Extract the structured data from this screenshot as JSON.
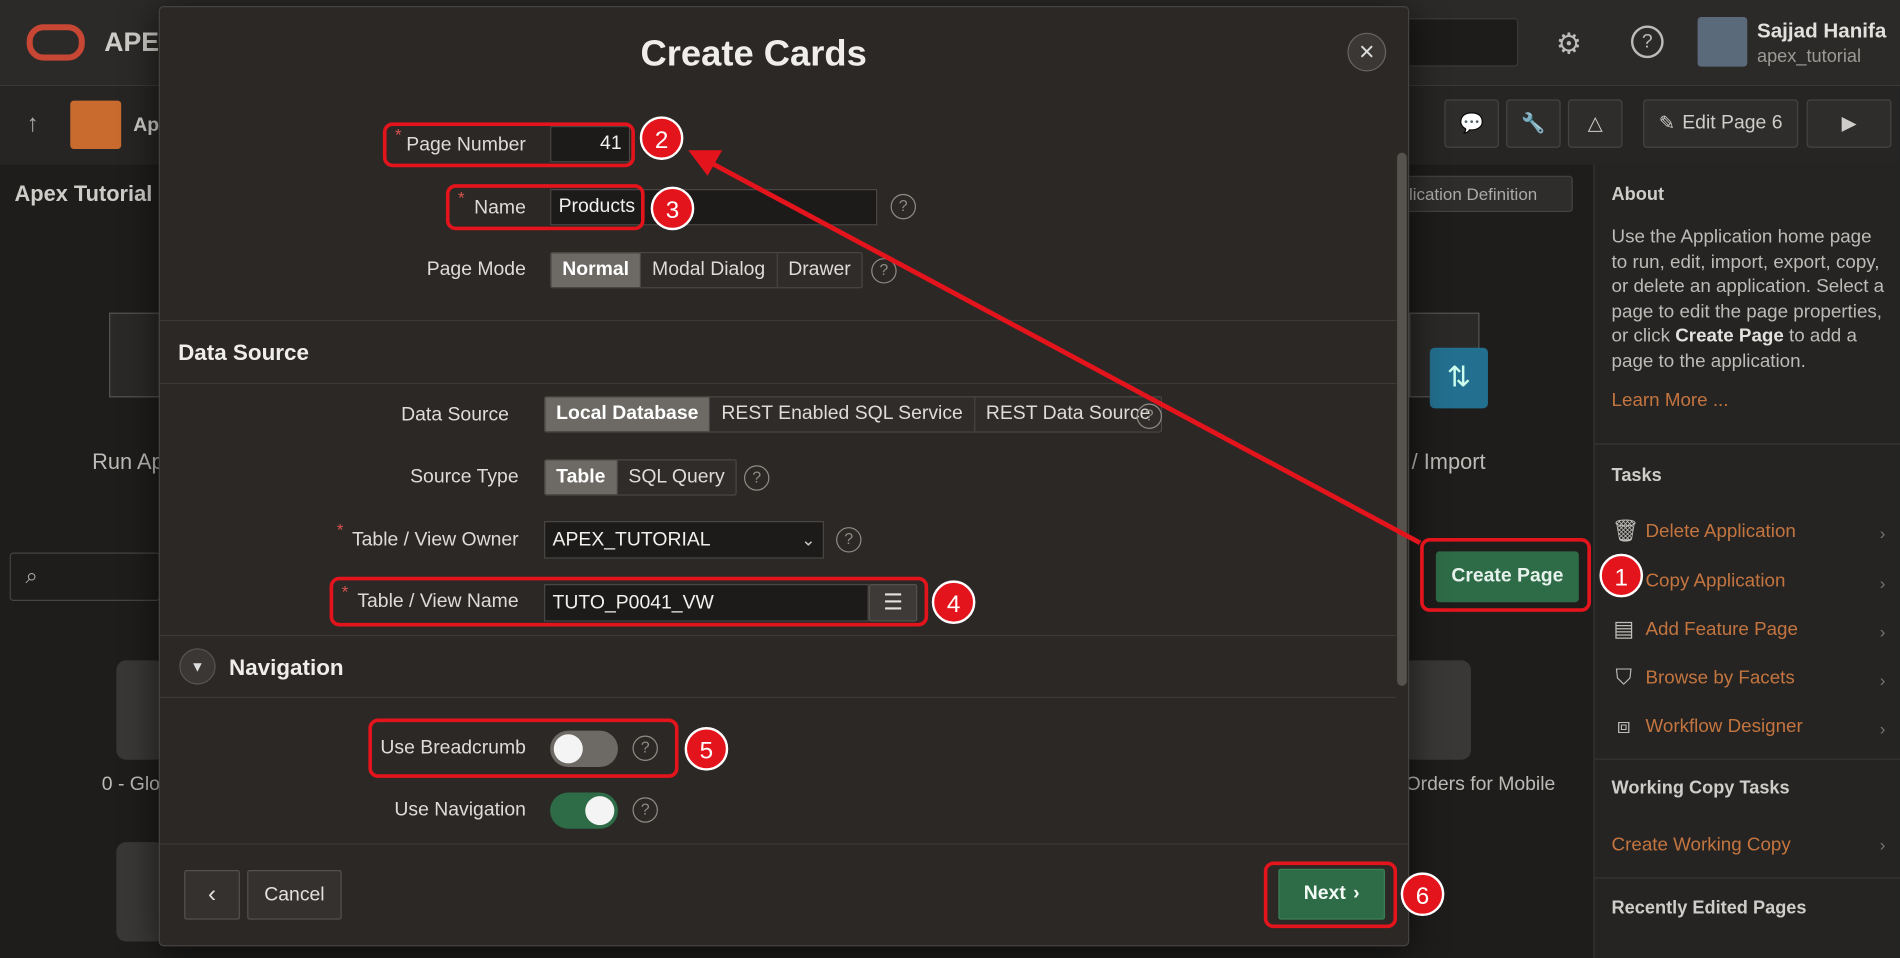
{
  "app": {
    "logo_text": "APEX",
    "user_name": "Sajjad Hanifa",
    "workspace": "apex_tutorial",
    "edit_page_label": "Edit Page 6"
  },
  "background": {
    "app_title": "Apex Tutorial",
    "breadcrumb_app": "Ap",
    "run_app_label": "Run Ap",
    "import_label": "/ Import",
    "app_def_label": "plication Definition",
    "create_page_label": "Create Page",
    "page0_label": "0 - Glo",
    "orders_label": "Orders for Mobile"
  },
  "right_panel": {
    "about_heading": "About",
    "about_text_1": "Use the Application home page to run, edit, import, export, copy, or delete an application. Select a page to edit the page properties, or click ",
    "about_bold": "Create Page",
    "about_text_2": " to add a page to the application.",
    "learn_more": "Learn More ...",
    "tasks_heading": "Tasks",
    "tasks": [
      "Delete Application",
      "Copy Application",
      "Add Feature Page",
      "Browse by Facets",
      "Workflow Designer"
    ],
    "working_copy_heading": "Working Copy Tasks",
    "create_working_copy": "Create Working Copy",
    "recent_heading": "Recently Edited Pages"
  },
  "dialog": {
    "title": "Create Cards",
    "page_number_label": "Page Number",
    "page_number_value": "41",
    "name_label": "Name",
    "name_value": "Products",
    "page_mode_label": "Page Mode",
    "page_mode_options": [
      "Normal",
      "Modal Dialog",
      "Drawer"
    ],
    "data_source_heading": "Data Source",
    "data_source_label": "Data Source",
    "data_source_options": [
      "Local Database",
      "REST Enabled SQL Service",
      "REST Data Source"
    ],
    "source_type_label": "Source Type",
    "source_type_options": [
      "Table",
      "SQL Query"
    ],
    "owner_label": "Table / View Owner",
    "owner_value": "APEX_TUTORIAL",
    "view_name_label": "Table / View Name",
    "view_name_value": "TUTO_P0041_VW",
    "navigation_heading": "Navigation",
    "breadcrumb_label": "Use Breadcrumb",
    "breadcrumb_on": false,
    "navigation_label": "Use Navigation",
    "navigation_on": true,
    "cancel_label": "Cancel",
    "next_label": "Next"
  },
  "annotations": [
    "1",
    "2",
    "3",
    "4",
    "5",
    "6"
  ],
  "colors": {
    "accent_red": "#e3141c",
    "primary_green": "#2e6b47",
    "link_orange": "#c4753f"
  }
}
